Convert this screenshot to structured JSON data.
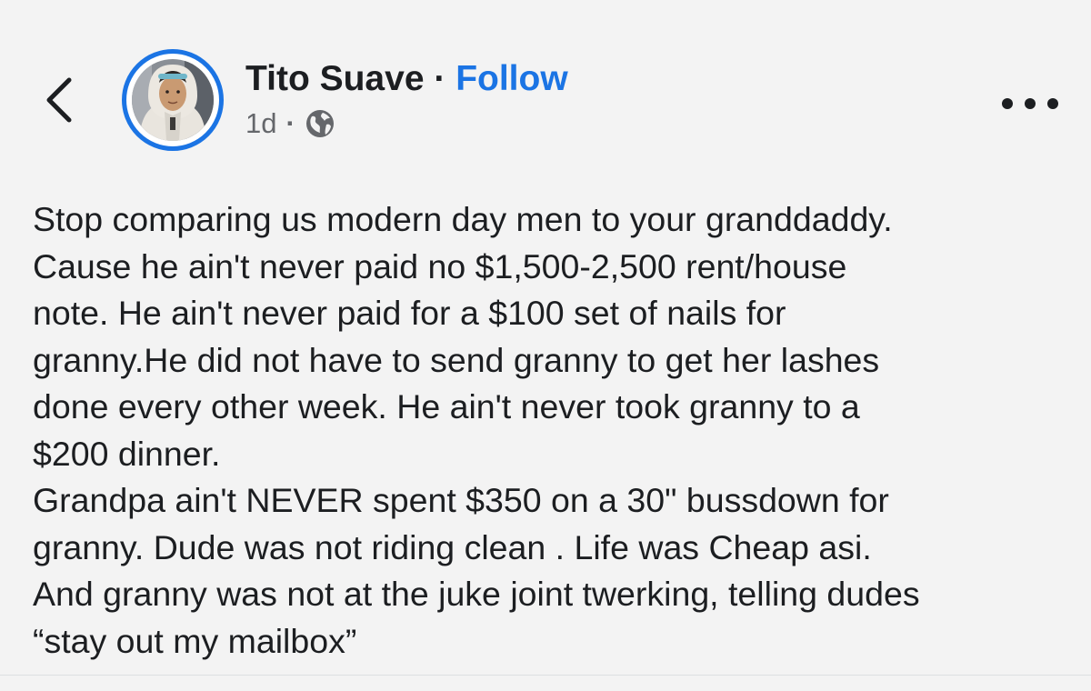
{
  "header": {
    "author_name": "Tito Suave",
    "separator": "·",
    "follow_label": "Follow",
    "timestamp": "1d",
    "meta_separator": "·",
    "audience_icon": "globe-icon",
    "back_icon": "chevron-left-icon",
    "more_icon": "more-horizontal-icon"
  },
  "post": {
    "paragraphs": [
      "Stop comparing us modern day men to your granddaddy.\nCause he ain't never paid no $1,500-2,500 rent/house\nnote. He ain't never paid for a $100 set of nails for\ngranny.He did not have to send granny to get her lashes\ndone every other week. He ain't never took granny to a\n$200 dinner.",
      "Grandpa ain't NEVER spent $350 on a 30\" bussdown for\ngranny. Dude was not riding clean . Life was Cheap asi.\nAnd granny was not at the juke joint twerking, telling dudes\n“stay out my mailbox”"
    ]
  },
  "colors": {
    "background": "#f3f3f3",
    "accent": "#1b74e4",
    "text": "#1c1e21",
    "secondary_text": "#65676b"
  }
}
